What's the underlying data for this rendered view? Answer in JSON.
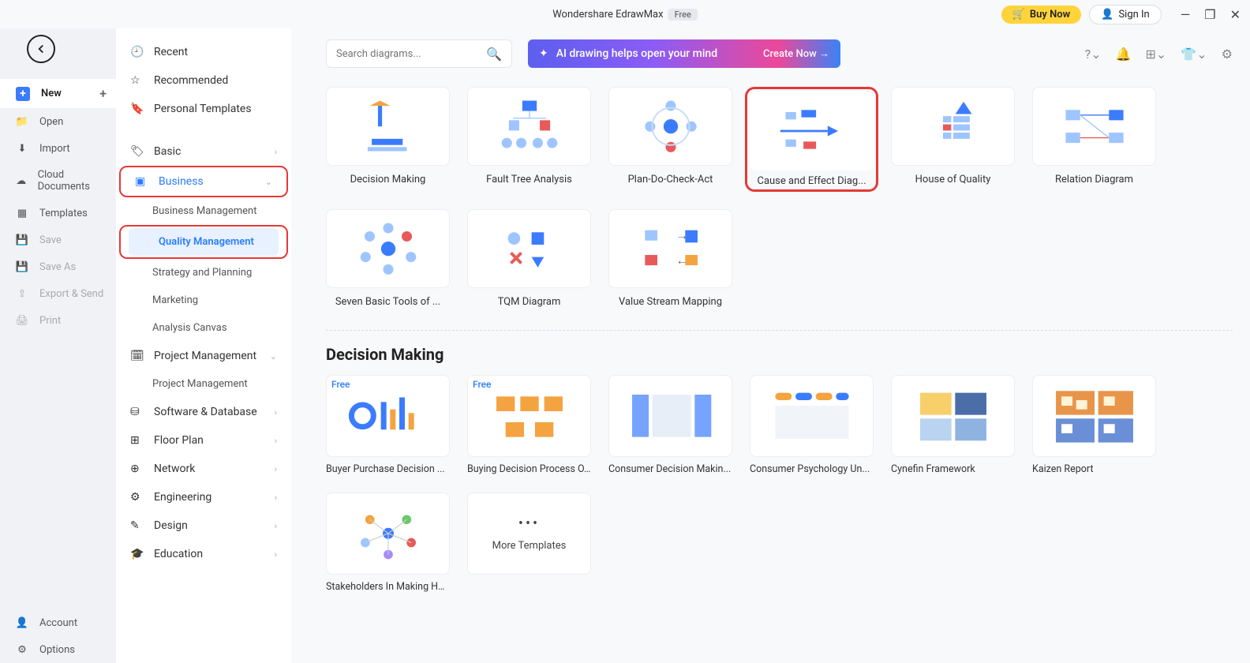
{
  "titlebar": {
    "app_name": "Wondershare EdrawMax",
    "badge": "Free",
    "buy_now": "Buy Now",
    "sign_in": "Sign In"
  },
  "left_panel": {
    "new": "New",
    "open": "Open",
    "import": "Import",
    "cloud_docs": "Cloud Documents",
    "templates": "Templates",
    "save": "Save",
    "save_as": "Save As",
    "export_send": "Export & Send",
    "print": "Print",
    "account": "Account",
    "options": "Options"
  },
  "categories": {
    "recent": "Recent",
    "recommended": "Recommended",
    "personal_templates": "Personal Templates",
    "basic": "Basic",
    "business": "Business",
    "biz_sub": {
      "biz_mgmt": "Business Management",
      "quality_mgmt": "Quality Management",
      "strategy": "Strategy and Planning",
      "marketing": "Marketing",
      "analysis": "Analysis Canvas"
    },
    "project_mgmt": "Project Management",
    "project_mgmt_sub": "Project Management",
    "software_db": "Software & Database",
    "floor_plan": "Floor Plan",
    "network": "Network",
    "engineering": "Engineering",
    "design": "Design",
    "education": "Education"
  },
  "search": {
    "placeholder": "Search diagrams..."
  },
  "ai_banner": {
    "text": "AI drawing helps open your mind",
    "cta": "Create Now"
  },
  "diagram_cards": [
    {
      "label": "Decision Making"
    },
    {
      "label": "Fault Tree Analysis"
    },
    {
      "label": "Plan-Do-Check-Act"
    },
    {
      "label": "Cause and Effect Diag..."
    },
    {
      "label": "House of Quality"
    },
    {
      "label": "Relation Diagram"
    },
    {
      "label": "Seven Basic Tools of ..."
    },
    {
      "label": "TQM Diagram"
    },
    {
      "label": "Value Stream Mapping"
    }
  ],
  "section_title": "Decision Making",
  "templates": [
    {
      "label": "Buyer Purchase Decision ...",
      "free": true
    },
    {
      "label": "Buying Decision Process O...",
      "free": true
    },
    {
      "label": "Consumer Decision Makin..."
    },
    {
      "label": "Consumer Psychology Un..."
    },
    {
      "label": "Cynefin Framework"
    },
    {
      "label": "Kaizen Report"
    },
    {
      "label": "Stakeholders In Making He..."
    }
  ],
  "more_templates": "More Templates"
}
